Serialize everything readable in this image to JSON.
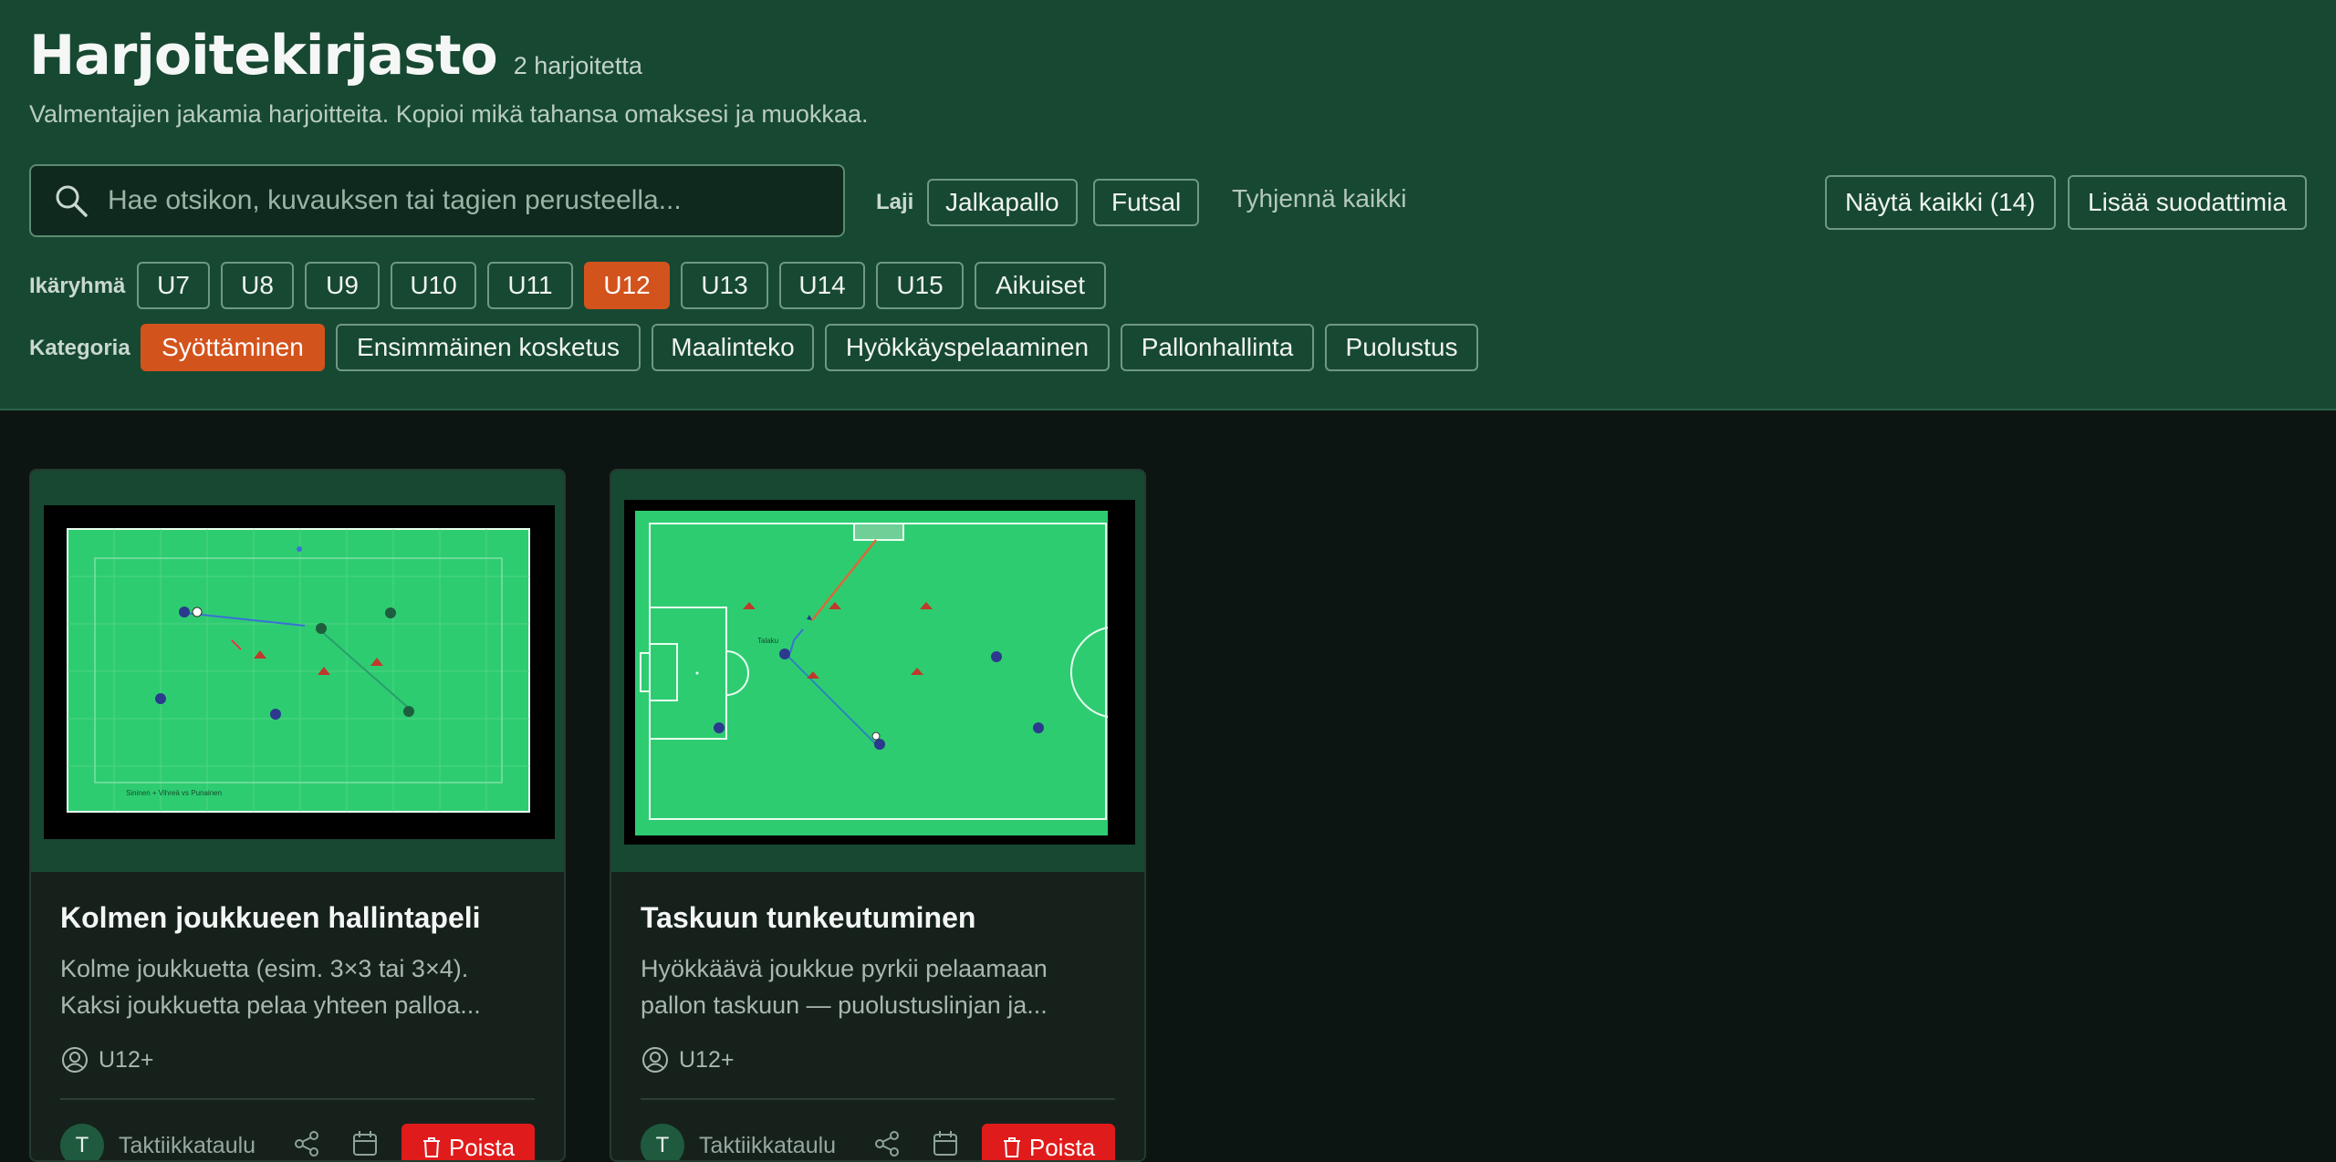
{
  "header": {
    "title": "Harjoitekirjasto",
    "count": "2 harjoitetta",
    "subtitle": "Valmentajien jakamia harjoitteita. Kopioi mikä tahansa omaksesi ja muokkaa."
  },
  "search": {
    "placeholder": "Hae otsikon, kuvauksen tai tagien perusteella..."
  },
  "sport": {
    "label": "Laji",
    "options": [
      "Jalkapallo",
      "Futsal"
    ],
    "clear": "Tyhjennä kaikki"
  },
  "actions": {
    "show_all": "Näytä kaikki (14)",
    "more_filters": "Lisää suodattimia"
  },
  "age": {
    "label": "Ikäryhmä",
    "options": [
      "U7",
      "U8",
      "U9",
      "U10",
      "U11",
      "U12",
      "U13",
      "U14",
      "U15",
      "Aikuiset"
    ],
    "selected": "U12"
  },
  "category": {
    "label": "Kategoria",
    "options": [
      "Syöttäminen",
      "Ensimmäinen kosketus",
      "Maalinteko",
      "Hyökkäyspelaaminen",
      "Pallonhallinta",
      "Puolustus"
    ],
    "selected": "Syöttäminen"
  },
  "cards": [
    {
      "title": "Kolmen joukkueen hallintapeli",
      "desc_line1": "Kolme joukkuetta (esim. 3×3 tai 3×4).",
      "desc_line2": "Kaksi joukkuetta pelaa yhteen palloa...",
      "age": "U12+",
      "avatar": "T",
      "owner": "Taktiikkataulu",
      "delete": "Poista",
      "diagram_caption": "Sininen + Vihreä vs Punainen"
    },
    {
      "title": "Taskuun tunkeutuminen",
      "desc_line1": "Hyökkäävä joukkue pyrkii pelaamaan",
      "desc_line2": "pallon taskuun — puolustuslinjan ja...",
      "age": "U12+",
      "avatar": "T",
      "owner": "Taktiikkataulu",
      "delete": "Poista",
      "diagram_label": "Talaku"
    }
  ],
  "colors": {
    "header_bg": "#174832",
    "accent": "#d3531d",
    "danger": "#e01b1b",
    "pitch": "#2ecc71",
    "team_blue": "#2b3a8c",
    "team_red": "#c0392b"
  }
}
